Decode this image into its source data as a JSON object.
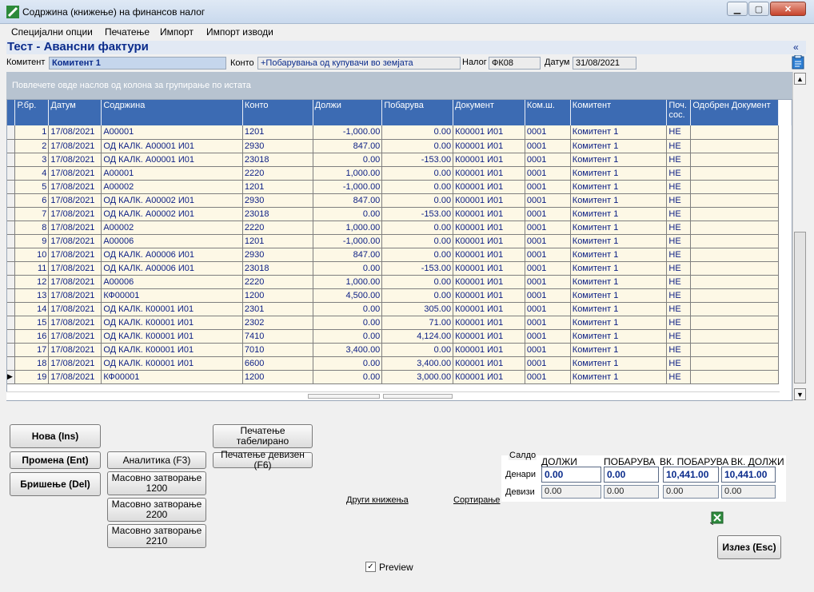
{
  "window": {
    "title": "Содржина (книжење) на финансов налог"
  },
  "menu": [
    "Специјални опции",
    "Печатење",
    "Импорт",
    "Импорт изводи"
  ],
  "form": {
    "heading": "Тест - Авансни фактури",
    "collapse_glyph": "«",
    "komitent_label": "Комитент",
    "komitent_value": "Комитент 1",
    "konto_label": "Конто",
    "konto_value": "+Побарувања од купувачи во земјата",
    "nalog_label": "Налог",
    "nalog_value": "ФК08",
    "datum_label": "Датум",
    "datum_value": "31/08/2021"
  },
  "grid": {
    "group_hint": "Повлечете овде наслов од колона за групирање по истата",
    "columns": [
      "Р.бр.",
      "Датум",
      "Содржина",
      "Конто",
      "Должи",
      "Побарува",
      "Документ",
      "Ком.ш.",
      "Комитент",
      "Поч. сос.",
      "Одобрен Документ"
    ],
    "rows": [
      [
        "1",
        "17/08/2021",
        "A00001",
        "1201",
        "-1,000.00",
        "0.00",
        "К00001 И01",
        "0001",
        "Комитент 1",
        "НЕ",
        ""
      ],
      [
        "2",
        "17/08/2021",
        "ОД КАЛК. A00001 И01",
        "2930",
        "847.00",
        "0.00",
        "К00001 И01",
        "0001",
        "Комитент 1",
        "НЕ",
        ""
      ],
      [
        "3",
        "17/08/2021",
        "ОД КАЛК. A00001 И01",
        "23018",
        "0.00",
        "-153.00",
        "К00001 И01",
        "0001",
        "Комитент 1",
        "НЕ",
        ""
      ],
      [
        "4",
        "17/08/2021",
        "A00001",
        "2220",
        "1,000.00",
        "0.00",
        "К00001 И01",
        "0001",
        "Комитент 1",
        "НЕ",
        ""
      ],
      [
        "5",
        "17/08/2021",
        "A00002",
        "1201",
        "-1,000.00",
        "0.00",
        "К00001 И01",
        "0001",
        "Комитент 1",
        "НЕ",
        ""
      ],
      [
        "6",
        "17/08/2021",
        "ОД КАЛК. A00002 И01",
        "2930",
        "847.00",
        "0.00",
        "К00001 И01",
        "0001",
        "Комитент 1",
        "НЕ",
        ""
      ],
      [
        "7",
        "17/08/2021",
        "ОД КАЛК. A00002 И01",
        "23018",
        "0.00",
        "-153.00",
        "К00001 И01",
        "0001",
        "Комитент 1",
        "НЕ",
        ""
      ],
      [
        "8",
        "17/08/2021",
        "A00002",
        "2220",
        "1,000.00",
        "0.00",
        "К00001 И01",
        "0001",
        "Комитент 1",
        "НЕ",
        ""
      ],
      [
        "9",
        "17/08/2021",
        "A00006",
        "1201",
        "-1,000.00",
        "0.00",
        "К00001 И01",
        "0001",
        "Комитент 1",
        "НЕ",
        ""
      ],
      [
        "10",
        "17/08/2021",
        "ОД КАЛК. A00006 И01",
        "2930",
        "847.00",
        "0.00",
        "К00001 И01",
        "0001",
        "Комитент 1",
        "НЕ",
        ""
      ],
      [
        "11",
        "17/08/2021",
        "ОД КАЛК. A00006 И01",
        "23018",
        "0.00",
        "-153.00",
        "К00001 И01",
        "0001",
        "Комитент 1",
        "НЕ",
        ""
      ],
      [
        "12",
        "17/08/2021",
        "A00006",
        "2220",
        "1,000.00",
        "0.00",
        "К00001 И01",
        "0001",
        "Комитент 1",
        "НЕ",
        ""
      ],
      [
        "13",
        "17/08/2021",
        "КФ00001",
        "1200",
        "4,500.00",
        "0.00",
        "К00001 И01",
        "0001",
        "Комитент 1",
        "НЕ",
        ""
      ],
      [
        "14",
        "17/08/2021",
        "ОД КАЛК. К00001 И01",
        "2301",
        "0.00",
        "305.00",
        "К00001 И01",
        "0001",
        "Комитент 1",
        "НЕ",
        ""
      ],
      [
        "15",
        "17/08/2021",
        "ОД КАЛК. К00001 И01",
        "2302",
        "0.00",
        "71.00",
        "К00001 И01",
        "0001",
        "Комитент 1",
        "НЕ",
        ""
      ],
      [
        "16",
        "17/08/2021",
        "ОД КАЛК. К00001 И01",
        "7410",
        "0.00",
        "4,124.00",
        "К00001 И01",
        "0001",
        "Комитент 1",
        "НЕ",
        ""
      ],
      [
        "17",
        "17/08/2021",
        "ОД КАЛК. К00001 И01",
        "7010",
        "3,400.00",
        "0.00",
        "К00001 И01",
        "0001",
        "Комитент 1",
        "НЕ",
        ""
      ],
      [
        "18",
        "17/08/2021",
        "ОД КАЛК. К00001 И01",
        "6600",
        "0.00",
        "3,400.00",
        "К00001 И01",
        "0001",
        "Комитент 1",
        "НЕ",
        ""
      ],
      [
        "19",
        "17/08/2021",
        "КФ00001",
        "1200",
        "0.00",
        "3,000.00",
        "К00001 И01",
        "0001",
        "Комитент 1",
        "НЕ",
        ""
      ]
    ],
    "current_row": 19
  },
  "buttons": {
    "nova": "Нова (Ins)",
    "promena": "Промена (Ent)",
    "brisenje": "Бришење (Del)",
    "analitika": "Аналитика (F3)",
    "masovno1200": "Масовно затворање\n1200",
    "masovno2200": "Масовно затворање\n2200",
    "masovno2210": "Масовно затворање\n2210",
    "pecatenje_tab": "Печатење\nтабелирано",
    "pecatenje_dev": "Печатење девизен (F6)",
    "izlez": "Излез (Esc)"
  },
  "links": {
    "drugi": "Други книжења",
    "sortiranje": "Сортирање"
  },
  "preview": {
    "label": "Preview",
    "checked": true
  },
  "saldo": {
    "title": "Салдо",
    "cols": [
      "ДОЛЖИ",
      "ПОБАРУВА",
      "ВК. ПОБАРУВА",
      "ВК. ДОЛЖИ"
    ],
    "denari_label": "Денари",
    "devizi_label": "Девизи",
    "denari": [
      "0.00",
      "0.00",
      "10,441.00",
      "10,441.00"
    ],
    "devizi": [
      "0.00",
      "0.00",
      "0.00",
      "0.00"
    ]
  },
  "icons": {
    "app": "app-logo-icon",
    "excel": "excel-export-icon",
    "clipboard": "clipboard-icon"
  }
}
